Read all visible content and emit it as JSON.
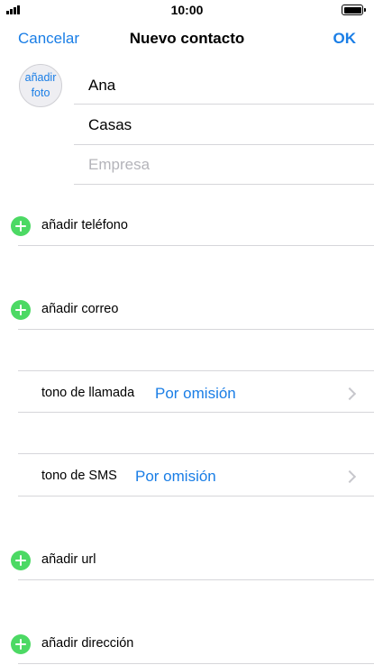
{
  "status_bar": {
    "time": "10:00",
    "signal_icon": "signal-bars-icon",
    "battery_icon": "battery-icon"
  },
  "nav": {
    "cancel_label": "Cancelar",
    "title": "Nuevo contacto",
    "ok_label": "OK"
  },
  "photo": {
    "line1": "añadir",
    "line2": "foto"
  },
  "name_fields": {
    "first_name": "Ana",
    "last_name": "Casas",
    "company_placeholder": "Empresa"
  },
  "rows": {
    "add_phone": "añadir teléfono",
    "add_email": "añadir correo",
    "ringtone_label": "tono de llamada",
    "ringtone_value": "Por omisión",
    "sms_tone_label": "tono de SMS",
    "sms_tone_value": "Por omisión",
    "add_url": "añadir url",
    "add_address": "añadir dirección"
  },
  "colors": {
    "accent": "#1a7ee6",
    "add_green": "#4cd964",
    "separator": "#d6d6da",
    "placeholder": "#b4b4ba"
  }
}
